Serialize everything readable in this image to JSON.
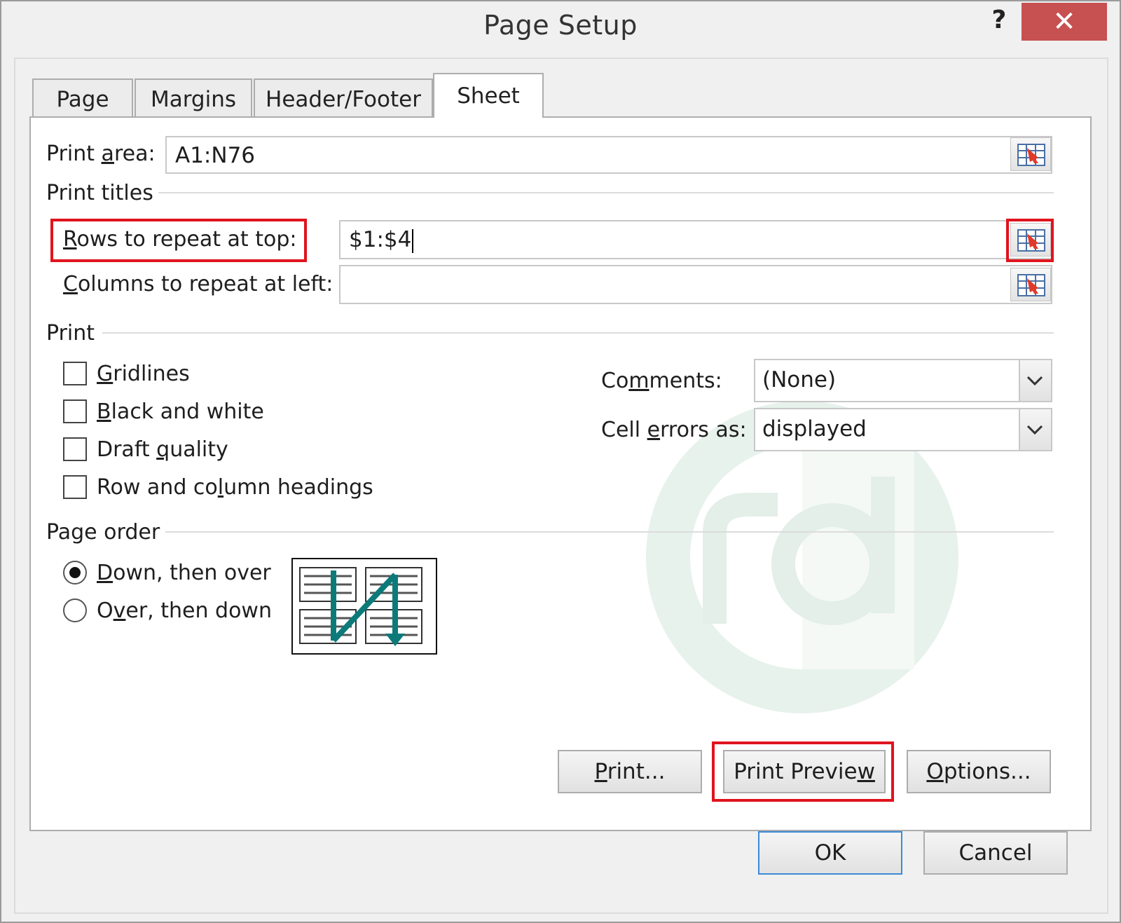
{
  "window": {
    "title": "Page Setup",
    "help_label": "?",
    "close_label": "✕"
  },
  "tabs": [
    {
      "label": "Page",
      "active": false
    },
    {
      "label": "Margins",
      "active": false
    },
    {
      "label": "Header/Footer",
      "active": false
    },
    {
      "label": "Sheet",
      "active": true
    }
  ],
  "print_area": {
    "label_pre": "Print ",
    "label_ul": "a",
    "label_post": "rea:",
    "value": "A1:N76"
  },
  "print_titles": {
    "heading": "Print titles",
    "rows": {
      "label_ul": "R",
      "label_post": "ows to repeat at top:",
      "value": "$1:$4"
    },
    "columns": {
      "label_ul": "C",
      "label_post": "olumns to repeat at left:",
      "value": ""
    }
  },
  "print": {
    "heading": "Print",
    "checkboxes": [
      {
        "pre": "",
        "ul": "G",
        "post": "ridlines",
        "checked": false
      },
      {
        "pre": "",
        "ul": "B",
        "post": "lack and white",
        "checked": false
      },
      {
        "pre": "Draft ",
        "ul": "q",
        "post": "uality",
        "checked": false
      },
      {
        "pre": "Row and co",
        "ul": "l",
        "post": "umn headings",
        "checked": false
      }
    ],
    "comments": {
      "pre": "Co",
      "ul": "m",
      "post": "ments:",
      "value": "(None)"
    },
    "cell_errors": {
      "pre": "Cell ",
      "ul": "e",
      "post": "rrors as:",
      "value": "displayed"
    }
  },
  "page_order": {
    "heading": "Page order",
    "options": [
      {
        "pre": "",
        "ul": "D",
        "post": "own, then over",
        "selected": true
      },
      {
        "pre": "O",
        "ul": "v",
        "post": "er, then down",
        "selected": false
      }
    ]
  },
  "buttons": {
    "print": {
      "pre": "",
      "ul": "P",
      "post": "rint..."
    },
    "preview": {
      "pre": "Print Previe",
      "ul": "w",
      "post": ""
    },
    "options": {
      "pre": "",
      "ul": "O",
      "post": "ptions..."
    },
    "ok": "OK",
    "cancel": "Cancel"
  },
  "colors": {
    "highlight": "#e0141e",
    "close_bg": "#c75050",
    "default_button_border": "#3c8ad8",
    "arrow": "#0d7a7a"
  },
  "icons": {
    "ref_button": "collapse-dialog-icon",
    "page_order_preview": "page-order-diagram-icon"
  }
}
